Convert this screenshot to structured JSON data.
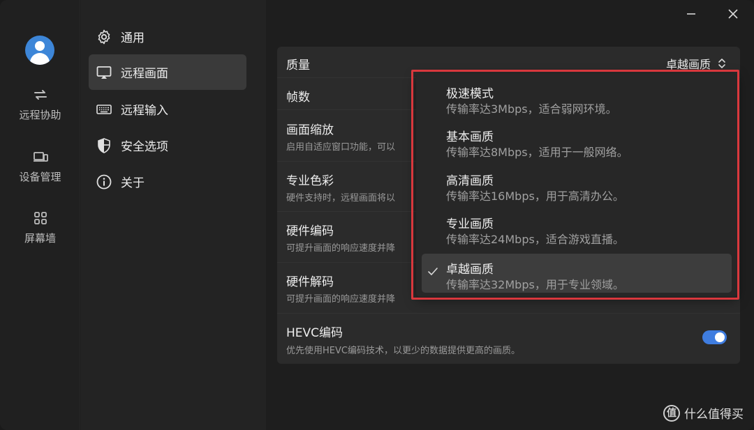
{
  "rail": {
    "items": [
      {
        "label": "远程协助",
        "icon": "swap-arrows-icon"
      },
      {
        "label": "设备管理",
        "icon": "devices-icon"
      },
      {
        "label": "屏幕墙",
        "icon": "grid-icon"
      }
    ]
  },
  "nav": {
    "items": [
      {
        "label": "通用",
        "icon": "gear-icon"
      },
      {
        "label": "远程画面",
        "icon": "monitor-icon"
      },
      {
        "label": "远程输入",
        "icon": "keyboard-icon"
      },
      {
        "label": "安全选项",
        "icon": "shield-icon"
      },
      {
        "label": "关于",
        "icon": "info-icon"
      }
    ],
    "active": 1
  },
  "settings": {
    "quality": {
      "title": "质量",
      "value": "卓越画质"
    },
    "fps": {
      "title": "帧数"
    },
    "scaling": {
      "title": "画面缩放",
      "desc": "启用自适应窗口功能，可以"
    },
    "color": {
      "title": "专业色彩",
      "desc": "硬件支持时，远程画面将以"
    },
    "hw_encode": {
      "title": "硬件编码",
      "desc": "可提升画面的响应速度并降"
    },
    "hw_decode": {
      "title": "硬件解码",
      "desc": "可提升画面的响应速度并降"
    },
    "hevc": {
      "title": "HEVC编码",
      "desc": "优先使用HEVC编码技术，以更少的数据提供更高的画质。",
      "enabled": true
    }
  },
  "dropdown": {
    "selected": 4,
    "items": [
      {
        "title": "极速模式",
        "desc": "传输率达3Mbps，适合弱网环境。"
      },
      {
        "title": "基本画质",
        "desc": "传输率达8Mbps，适用于一般网络。"
      },
      {
        "title": "高清画质",
        "desc": "传输率达16Mbps，用于高清办公。"
      },
      {
        "title": "专业画质",
        "desc": "传输率达24Mbps，适合游戏直播。"
      },
      {
        "title": "卓越画质",
        "desc": "传输率达32Mbps，用于专业领域。"
      }
    ]
  },
  "watermark": {
    "logo": "值",
    "text": "什么值得买"
  },
  "colors": {
    "accent": "#3f7de0",
    "highlight": "#d9383d",
    "avatar": "#3d86d8"
  }
}
